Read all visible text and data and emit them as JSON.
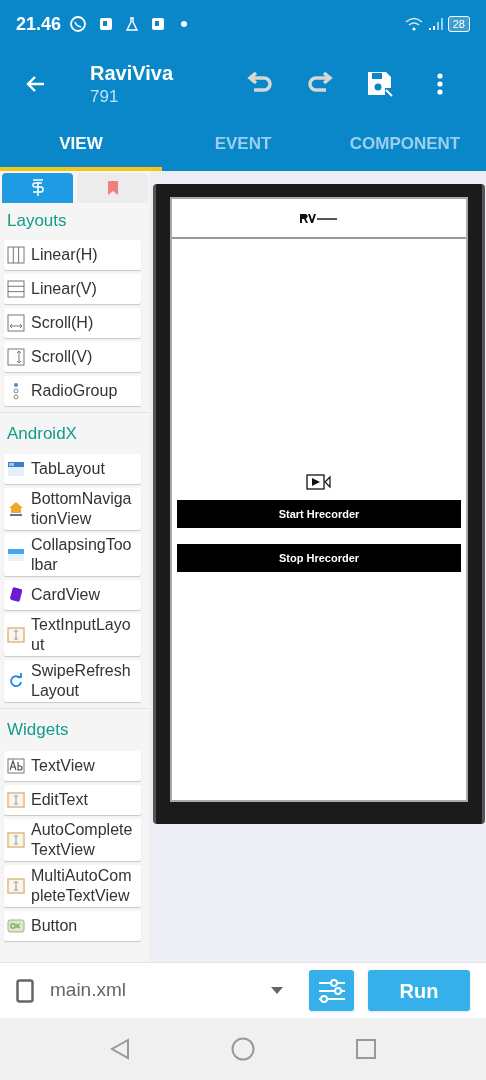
{
  "status_bar": {
    "time": "21.46",
    "battery": "28"
  },
  "app_bar": {
    "title": "RaviViva",
    "subtitle": "791"
  },
  "tabs": [
    {
      "label": "VIEW",
      "selected": true
    },
    {
      "label": "EVENT",
      "selected": false
    },
    {
      "label": "COMPONENT",
      "selected": false
    }
  ],
  "palette_tabs": [
    {
      "selected": true
    },
    {
      "selected": false
    }
  ],
  "palette": [
    {
      "heading": "Layouts",
      "items": [
        "Linear(H)",
        "Linear(V)",
        "Scroll(H)",
        "Scroll(V)",
        "RadioGroup"
      ]
    },
    {
      "heading": "AndroidX",
      "items": [
        "TabLayout",
        "BottomNavigationView",
        "CollapsingToolbar",
        "CardView",
        "TextInputLayout",
        "SwipeRefreshLayout"
      ]
    },
    {
      "heading": "Widgets",
      "items": [
        "TextView",
        "EditText",
        "AutoCompleteTextView",
        "MultiAutoCompleteTextView",
        "Button"
      ]
    }
  ],
  "preview": {
    "buttons": [
      "Start Hrecorder",
      "Stop Hrecorder"
    ]
  },
  "bottom_bar": {
    "file": "main.xml",
    "run": "Run"
  }
}
